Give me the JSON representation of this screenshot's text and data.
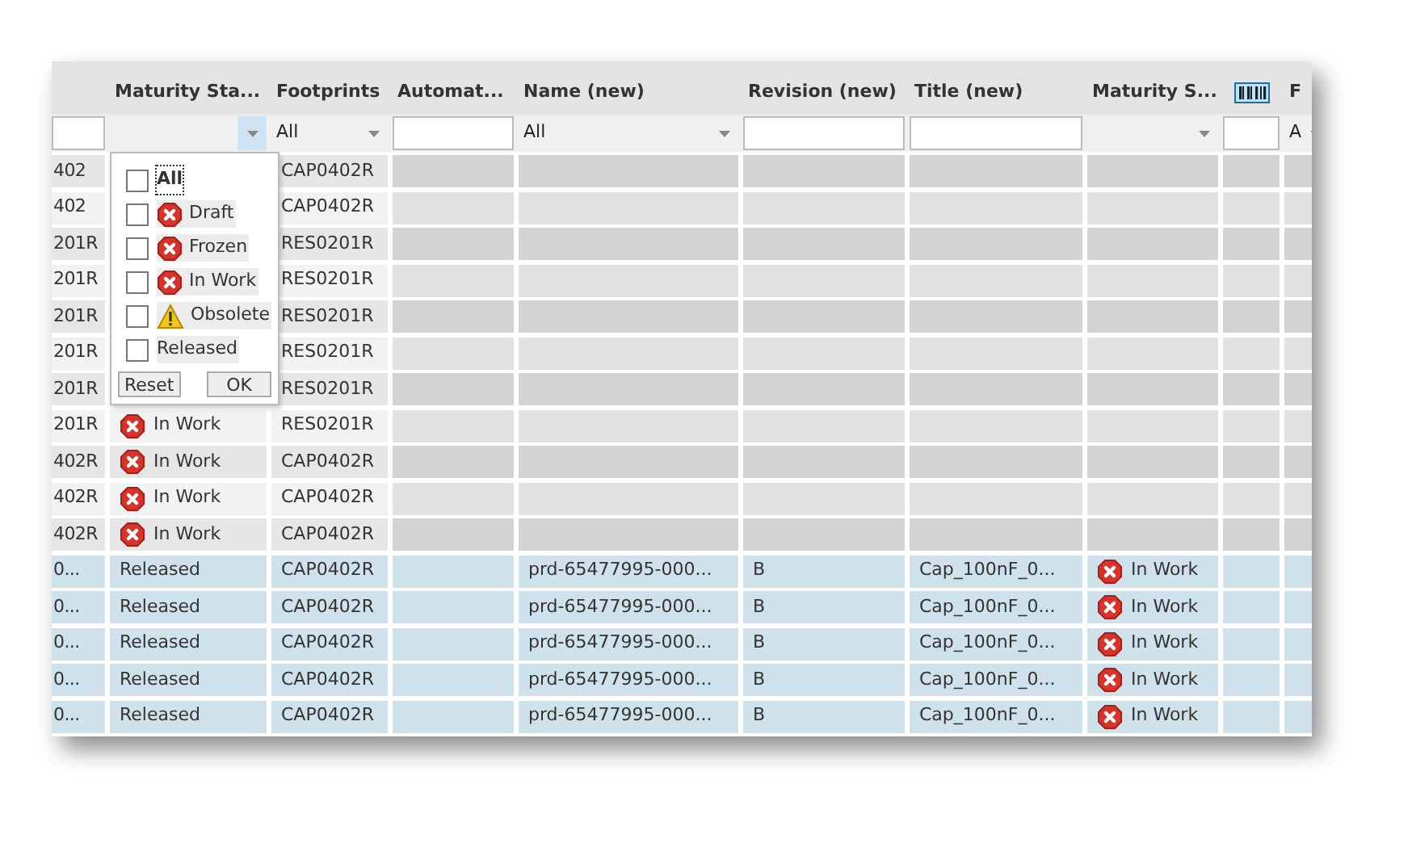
{
  "columns": [
    {
      "filter": {
        "kind": "text"
      }
    },
    {
      "label": "Maturity Sta...",
      "filter": {
        "kind": "select",
        "open": true
      }
    },
    {
      "label": "Footprints",
      "filter": {
        "kind": "select",
        "value": "All",
        "open": false
      }
    },
    {
      "label": "Automat...",
      "filter": {
        "kind": "text"
      }
    },
    {
      "label": "Name (new)",
      "filter": {
        "kind": "select",
        "value": "All",
        "open": false
      }
    },
    {
      "label": "Revision (new)",
      "filter": {
        "kind": "text"
      }
    },
    {
      "label": "Title (new)",
      "filter": {
        "kind": "text"
      }
    },
    {
      "label": "Maturity S...",
      "filter": {
        "kind": "select",
        "open": false
      }
    },
    {
      "kind": "barcode",
      "filter": {
        "kind": "text"
      }
    },
    {
      "label": "F",
      "filter": {
        "kind": "select",
        "value": "A",
        "open": false
      }
    }
  ],
  "rows": [
    {
      "selected": false,
      "cells": [
        {
          "text": "402"
        },
        null,
        {
          "text": "CAP0402R"
        }
      ]
    },
    {
      "selected": false,
      "cells": [
        {
          "text": "402"
        },
        null,
        {
          "text": "CAP0402R"
        }
      ]
    },
    {
      "selected": false,
      "cells": [
        {
          "text": "201R"
        },
        null,
        {
          "text": "RES0201R"
        }
      ]
    },
    {
      "selected": false,
      "cells": [
        {
          "text": "201R"
        },
        null,
        {
          "text": "RES0201R"
        }
      ]
    },
    {
      "selected": false,
      "cells": [
        {
          "text": "201R"
        },
        null,
        {
          "text": "RES0201R"
        }
      ]
    },
    {
      "selected": false,
      "cells": [
        {
          "text": "201R"
        },
        null,
        {
          "text": "RES0201R"
        }
      ]
    },
    {
      "selected": false,
      "cells": [
        {
          "text": "201R"
        },
        null,
        {
          "text": "RES0201R"
        }
      ]
    },
    {
      "selected": false,
      "cells": [
        {
          "text": "201R"
        },
        {
          "text": "In Work",
          "kind": "error"
        },
        {
          "text": "RES0201R"
        }
      ]
    },
    {
      "selected": false,
      "cells": [
        {
          "text": "402R"
        },
        {
          "text": "In Work",
          "kind": "error"
        },
        {
          "text": "CAP0402R"
        }
      ]
    },
    {
      "selected": false,
      "cells": [
        {
          "text": "402R"
        },
        {
          "text": "In Work",
          "kind": "error"
        },
        {
          "text": "CAP0402R"
        }
      ]
    },
    {
      "selected": false,
      "cells": [
        {
          "text": "402R"
        },
        {
          "text": "In Work",
          "kind": "error"
        },
        {
          "text": "CAP0402R"
        }
      ]
    },
    {
      "selected": true,
      "cells": [
        {
          "text": "0..."
        },
        {
          "text": "Released"
        },
        {
          "text": "CAP0402R"
        },
        null,
        {
          "text": "prd-65477995-000..."
        },
        {
          "text": "B"
        },
        {
          "text": "Cap_100nF_0..."
        },
        {
          "text": "In Work",
          "kind": "error"
        }
      ]
    },
    {
      "selected": true,
      "cells": [
        {
          "text": "0..."
        },
        {
          "text": "Released"
        },
        {
          "text": "CAP0402R"
        },
        null,
        {
          "text": "prd-65477995-000..."
        },
        {
          "text": "B"
        },
        {
          "text": "Cap_100nF_0..."
        },
        {
          "text": "In Work",
          "kind": "error"
        }
      ]
    },
    {
      "selected": true,
      "cells": [
        {
          "text": "0..."
        },
        {
          "text": "Released"
        },
        {
          "text": "CAP0402R"
        },
        null,
        {
          "text": "prd-65477995-000..."
        },
        {
          "text": "B"
        },
        {
          "text": "Cap_100nF_0..."
        },
        {
          "text": "In Work",
          "kind": "error"
        }
      ]
    },
    {
      "selected": true,
      "cells": [
        {
          "text": "0..."
        },
        {
          "text": "Released"
        },
        {
          "text": "CAP0402R"
        },
        null,
        {
          "text": "prd-65477995-000..."
        },
        {
          "text": "B"
        },
        {
          "text": "Cap_100nF_0..."
        },
        {
          "text": "In Work",
          "kind": "error"
        }
      ]
    },
    {
      "selected": true,
      "cells": [
        {
          "text": "0..."
        },
        {
          "text": "Released"
        },
        {
          "text": "CAP0402R"
        },
        null,
        {
          "text": "prd-65477995-000..."
        },
        {
          "text": "B"
        },
        {
          "text": "Cap_100nF_0..."
        },
        {
          "text": "In Work",
          "kind": "error"
        }
      ]
    }
  ],
  "filter_popup": {
    "options": [
      {
        "label": "All",
        "checked": false,
        "focused": true
      },
      {
        "label": "Draft",
        "kind": "error",
        "checked": false,
        "focused": false
      },
      {
        "label": "Frozen",
        "kind": "error",
        "checked": false,
        "focused": false
      },
      {
        "label": "In Work",
        "kind": "error",
        "checked": false,
        "focused": false
      },
      {
        "label": "Obsolete",
        "kind": "warning",
        "checked": false,
        "focused": false
      },
      {
        "label": "Released",
        "checked": false,
        "focused": false
      }
    ],
    "buttons": [
      "Reset",
      "OK"
    ]
  }
}
